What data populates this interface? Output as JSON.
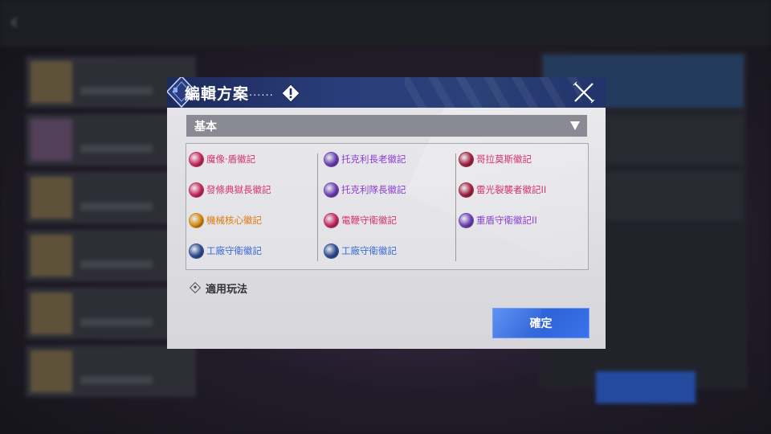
{
  "background": {
    "title": "",
    "list_items": [
      "",
      "",
      "",
      "",
      "",
      ""
    ],
    "confirm_label": ""
  },
  "dialog": {
    "title": "編輯方案",
    "title_dots": "......",
    "plan_select": {
      "selected": "基本"
    },
    "emblems": [
      {
        "label": "魔像·盾徽記",
        "color": "#d6336c",
        "icon_color": "#c2285a",
        "icon": "shield-emblem-icon"
      },
      {
        "label": "托克利長老徽記",
        "color": "#8a3fd0",
        "icon_color": "#6a3fb0",
        "icon": "spider-emblem-icon"
      },
      {
        "label": "哥拉莫斯徽記",
        "color": "#d6336c",
        "icon_color": "#a02040",
        "icon": "dragon-emblem-icon"
      },
      {
        "label": "發條典獄長徽記",
        "color": "#d6336c",
        "icon_color": "#c2285a",
        "icon": "warden-emblem-icon"
      },
      {
        "label": "托克利隊長徽記",
        "color": "#8a3fd0",
        "icon_color": "#6a3fb0",
        "icon": "spider-emblem-icon"
      },
      {
        "label": "雷光裂襲者徽記II",
        "color": "#d6336c",
        "icon_color": "#a02040",
        "icon": "raider-emblem-icon"
      },
      {
        "label": "機械核心徽記",
        "color": "#e07a10",
        "icon_color": "#d08a10",
        "icon": "core-emblem-icon"
      },
      {
        "label": "電鞭守衛徽記",
        "color": "#d6336c",
        "icon_color": "#c2285a",
        "icon": "whip-emblem-icon"
      },
      {
        "label": "重盾守衛徽記II",
        "color": "#8a3fd0",
        "icon_color": "#6a3fb0",
        "icon": "heavy-shield-emblem-icon"
      },
      {
        "label": "工廠守衛徽記",
        "color": "#3a6ad6",
        "icon_color": "#2a4a90",
        "icon": "factory-emblem-icon"
      },
      {
        "label": "工廠守衛徽記",
        "color": "#3a6ad6",
        "icon_color": "#2a4a90",
        "icon": "factory-emblem-icon"
      }
    ],
    "rules_label": "適用玩法",
    "confirm_label": "確定"
  },
  "colors": {
    "header": "#2a3d7a",
    "confirm": "#2f63d8",
    "select": "#8a8a95"
  }
}
